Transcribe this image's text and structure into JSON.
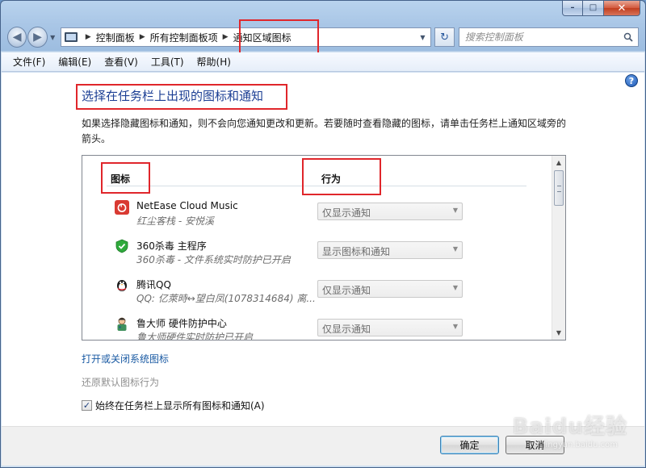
{
  "window": {
    "caption_buttons": {
      "minimize": "–",
      "maximize": "□",
      "close": "✕"
    }
  },
  "nav": {
    "back_glyph": "◀",
    "forward_glyph": "▶",
    "history_glyph": "▼",
    "breadcrumbs": [
      "控制面板",
      "所有控制面板项",
      "通知区域图标"
    ],
    "crumb_separator": "▶",
    "dropdown_glyph": "▼",
    "refresh_glyph": "↻",
    "search_placeholder": "搜索控制面板"
  },
  "menu": {
    "items": [
      "文件(F)",
      "编辑(E)",
      "查看(V)",
      "工具(T)",
      "帮助(H)"
    ]
  },
  "content": {
    "help_glyph": "?",
    "title": "选择在任务栏上出现的图标和通知",
    "description": "如果选择隐藏图标和通知，则不会向您通知更改和更新。若要随时查看隐藏的图标，请单击任务栏上通知区域旁的箭头。",
    "columns": {
      "icon": "图标",
      "behavior": "行为"
    },
    "rows": [
      {
        "name": "NetEase Cloud Music",
        "sub": "红尘客栈 - 安悦溪",
        "behavior": "仅显示通知",
        "icon": "netease-music-icon"
      },
      {
        "name": "360杀毒 主程序",
        "sub": "360杀毒 - 文件系统实时防护已开启",
        "behavior": "显示图标和通知",
        "icon": "360-antivirus-icon"
      },
      {
        "name": "腾讯QQ",
        "sub": "QQ: 亿萊時↔望白凤(1078314684)  离...",
        "behavior": "仅显示通知",
        "icon": "qq-penguin-icon"
      },
      {
        "name": "鲁大师 硬件防护中心",
        "sub": "鲁大师硬件实时防护已开启",
        "behavior": "仅显示通知",
        "icon": "ludashi-icon"
      }
    ],
    "combo_arrow": "▼",
    "scroll_up": "▲",
    "scroll_down": "▼",
    "link_system_icons": "打开或关闭系统图标",
    "link_restore": "还原默认图标行为",
    "checkbox_label": "始终在任务栏上显示所有图标和通知(A)",
    "checkbox_checked": true,
    "checkbox_glyph": "✓"
  },
  "buttons": {
    "ok": "确定",
    "cancel": "取消"
  },
  "watermark": {
    "text": "Baidu经验",
    "sub": "jingyan.baidu.com"
  },
  "colors": {
    "title_blue": "#1c3f94",
    "link_blue": "#1a5aa3",
    "annotation_red": "#e0262b"
  }
}
